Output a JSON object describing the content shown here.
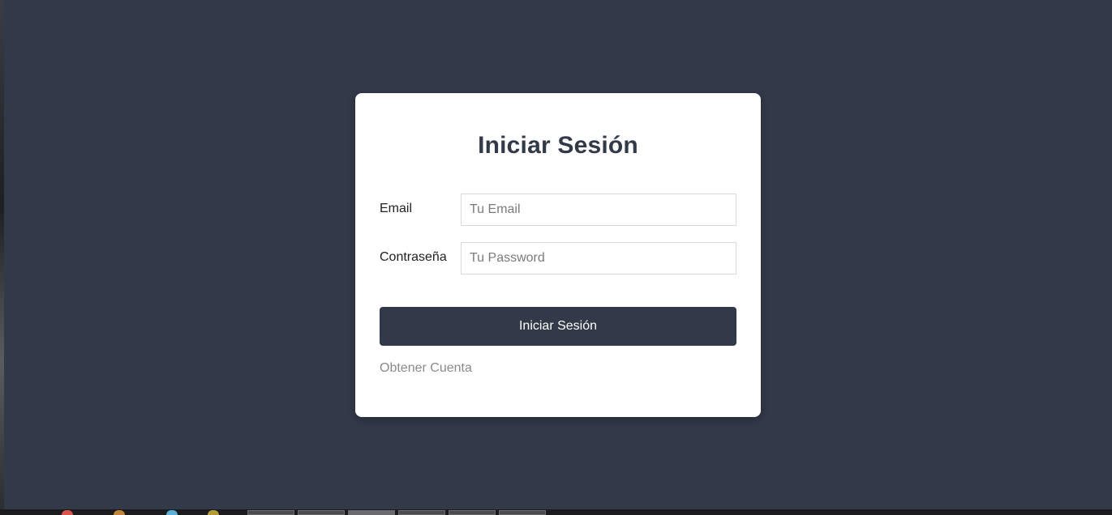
{
  "login": {
    "title": "Iniciar Sesión",
    "email_label": "Email",
    "email_placeholder": "Tu Email",
    "email_value": "",
    "password_label": "Contraseña",
    "password_placeholder": "Tu Password",
    "password_value": "",
    "submit_label": "Iniciar Sesión",
    "account_link": "Obtener Cuenta"
  },
  "colors": {
    "page_background": "#323948",
    "card_background": "#ffffff",
    "primary": "#323948",
    "link": "#8a8a8a"
  },
  "taskbar": {
    "icons": [
      "browser-icon",
      "app-icon",
      "folder-icon",
      "app-icon",
      "app-icon",
      "app-icon",
      "app-icon",
      "app-icon"
    ]
  }
}
